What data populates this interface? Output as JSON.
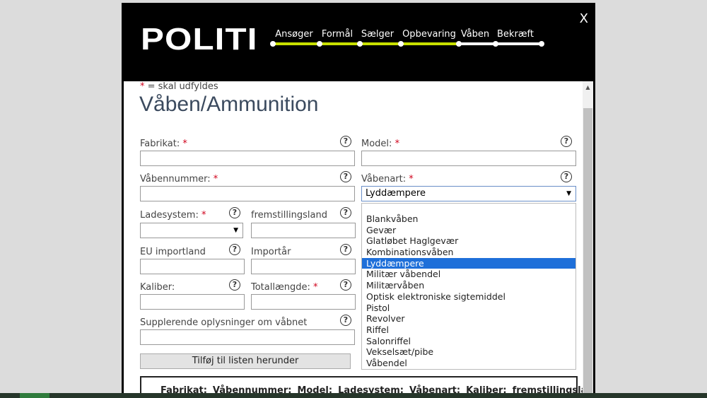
{
  "header": {
    "logo": "POLITI",
    "close_label": "X",
    "steps": [
      {
        "label": "Ansøger",
        "x": 0
      },
      {
        "label": "Formål",
        "x": 0
      },
      {
        "label": "Sælger",
        "x": 0
      },
      {
        "label": "Opbevaring",
        "x": 0
      },
      {
        "label": "Våben",
        "x": 0
      },
      {
        "label": "Bekræft",
        "x": 0
      }
    ],
    "completed_steps": 4,
    "progress_color": "#c8e000",
    "pending_color": "#ffffff"
  },
  "form": {
    "required_note_star": "*",
    "required_note": " = skal udfyldes",
    "title": "Våben/Ammunition",
    "fields": {
      "fabrikat": {
        "label": "Fabrikat:",
        "required": "*",
        "value": ""
      },
      "model": {
        "label": "Model:",
        "required": "*",
        "value": ""
      },
      "vaabennummer": {
        "label": "Våbennummer:",
        "required": "*",
        "value": ""
      },
      "vaabenart": {
        "label": "Våbenart:",
        "required": "*",
        "value": "Lyddæmpere"
      },
      "ladesystem": {
        "label": "Ladesystem:",
        "required": "*",
        "value": ""
      },
      "fremstillingsland": {
        "label": "fremstillingsland",
        "value": ""
      },
      "eu_importland": {
        "label": "EU importland",
        "value": ""
      },
      "importaar": {
        "label": "Importår",
        "value": ""
      },
      "kaliber": {
        "label": "Kaliber:",
        "value": ""
      },
      "totallaengde": {
        "label": "Totallængde:",
        "required": "*",
        "value": ""
      },
      "supplerende": {
        "label": "Supplerende oplysninger om våbnet",
        "value": ""
      }
    },
    "help_icon": "?",
    "add_button": "Tilføj til listen herunder"
  },
  "vaabenart_options": [
    "Blankvåben",
    "Gevær",
    "Glatløbet Haglgevær",
    "Kombinationsvåben",
    "Lyddæmpere",
    "Militær våbendel",
    "Militærvåben",
    "Optisk elektroniske sigtemiddel",
    "Pistol",
    "Revolver",
    "Riffel",
    "Salonriffel",
    "Vekselsæt/pibe",
    "Våbendel"
  ],
  "selected_option_index": 4,
  "list_table": {
    "columns": [
      "Fabrikat:",
      "Våbennummer:",
      "Model:",
      "Ladesystem:",
      "Våbenart:",
      "Kaliber:",
      "fremstillingsland"
    ]
  },
  "colors": {
    "selected_option": "#1e6fd9",
    "required_star": "#d0021b",
    "title": "#3b4a5e"
  }
}
